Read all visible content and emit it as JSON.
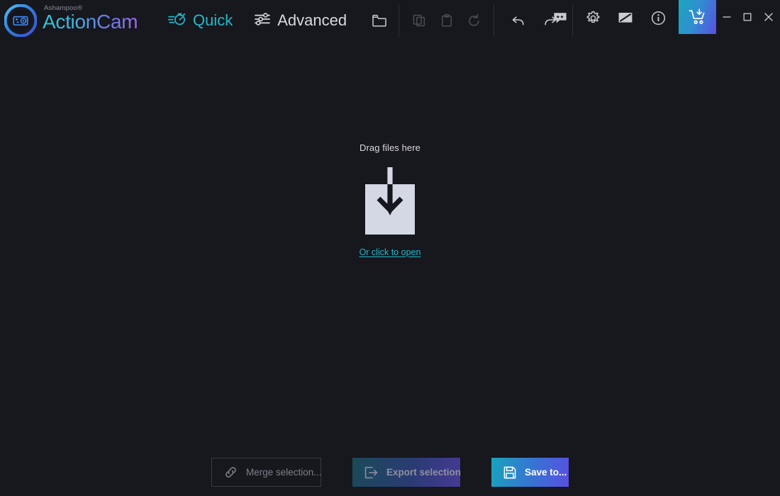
{
  "app": {
    "vendor": "Ashampoo®",
    "name": "ActionCam",
    "logo_icon": "camera-circle-logo"
  },
  "modes": [
    {
      "id": "quick",
      "label": "Quick",
      "icon": "stopwatch-speed-icon",
      "active": true
    },
    {
      "id": "advanced",
      "label": "Advanced",
      "icon": "sliders-icon",
      "active": false
    }
  ],
  "toolbar": {
    "groups": [
      {
        "items": [
          {
            "id": "open-folder",
            "icon": "folder-open-icon",
            "enabled": true
          }
        ]
      },
      {
        "items": [
          {
            "id": "copy",
            "icon": "copy-icon",
            "enabled": false
          },
          {
            "id": "paste",
            "icon": "clipboard-icon",
            "enabled": false
          },
          {
            "id": "reset",
            "icon": "reset-icon",
            "enabled": false
          }
        ]
      },
      {
        "items": [
          {
            "id": "undo",
            "icon": "undo-arrow-icon",
            "enabled": true
          },
          {
            "id": "redo",
            "icon": "redo-arrow-icon",
            "enabled": true
          }
        ]
      }
    ]
  },
  "right_actions": [
    {
      "id": "feedback",
      "icon": "speech-bubble-stars-icon"
    },
    {
      "id": "settings",
      "icon": "gear-icon"
    },
    {
      "id": "theme",
      "icon": "theme-contrast-icon"
    },
    {
      "id": "info",
      "icon": "info-circle-icon"
    }
  ],
  "cart": {
    "icon": "cart-download-icon"
  },
  "window_controls": [
    {
      "id": "minimize",
      "icon": "minimize-icon"
    },
    {
      "id": "maximize",
      "icon": "maximize-icon"
    },
    {
      "id": "close",
      "icon": "close-icon"
    }
  ],
  "dropzone": {
    "title": "Drag files here",
    "link": "Or click to open",
    "icon": "download-arrow-box-icon"
  },
  "bottom_actions": [
    {
      "id": "merge",
      "label": "Merge selection...",
      "icon": "link-chain-icon",
      "enabled": false,
      "style": "outline"
    },
    {
      "id": "export",
      "label": "Export selection",
      "icon": "export-box-icon",
      "enabled": false,
      "style": "gradient-muted"
    },
    {
      "id": "save",
      "label": "Save to...",
      "icon": "floppy-save-icon",
      "enabled": true,
      "style": "gradient"
    }
  ],
  "colors": {
    "background": "#17171e",
    "accent_teal": "#22b9c9",
    "accent_purple": "#9b6bf0",
    "text_primary": "#d9dade",
    "text_muted": "#7e7f8b",
    "dropzone_box": "#d3d8e4",
    "separator": "#2e2e38"
  }
}
